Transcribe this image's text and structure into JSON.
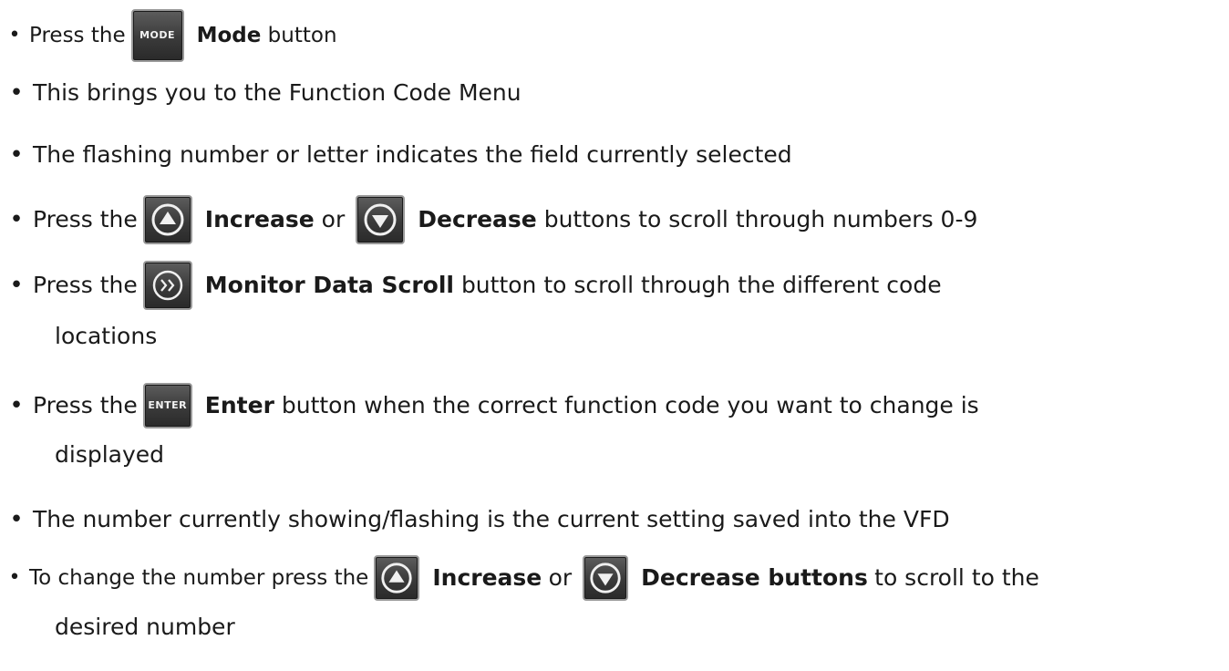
{
  "bullets": {
    "small": "•",
    "large": "•"
  },
  "keys": {
    "mode": "MODE",
    "enter": "ENTER"
  },
  "icons": {
    "increase": "up-arrow-icon",
    "decrease": "down-arrow-icon",
    "scroll": "double-chevron-right-icon"
  },
  "lines": {
    "l1": {
      "a": "Press the",
      "b": "Mode",
      "c": "button"
    },
    "l2": {
      "a": "This brings you to the Function Code Menu"
    },
    "l3": {
      "a": "The flashing number or letter indicates the field currently selected"
    },
    "l4": {
      "a": "Press the",
      "b": "Increase",
      "c": "or",
      "d": "Decrease",
      "e": "buttons to scroll through numbers 0-9"
    },
    "l5": {
      "a": "Press the",
      "b": "Monitor Data Scroll",
      "c": "button to scroll through the different code",
      "cont": "locations"
    },
    "l6": {
      "a": "Press the",
      "b": "Enter",
      "c": "button when the correct function code you want to change is",
      "cont": "displayed"
    },
    "l7": {
      "a": "The number currently showing/flashing is the current setting saved into the VFD"
    },
    "l8": {
      "a": "To change the number press the",
      "b": "Increase",
      "c": "or",
      "d": "Decrease buttons",
      "e": "to scroll to the",
      "cont": "desired number"
    }
  }
}
